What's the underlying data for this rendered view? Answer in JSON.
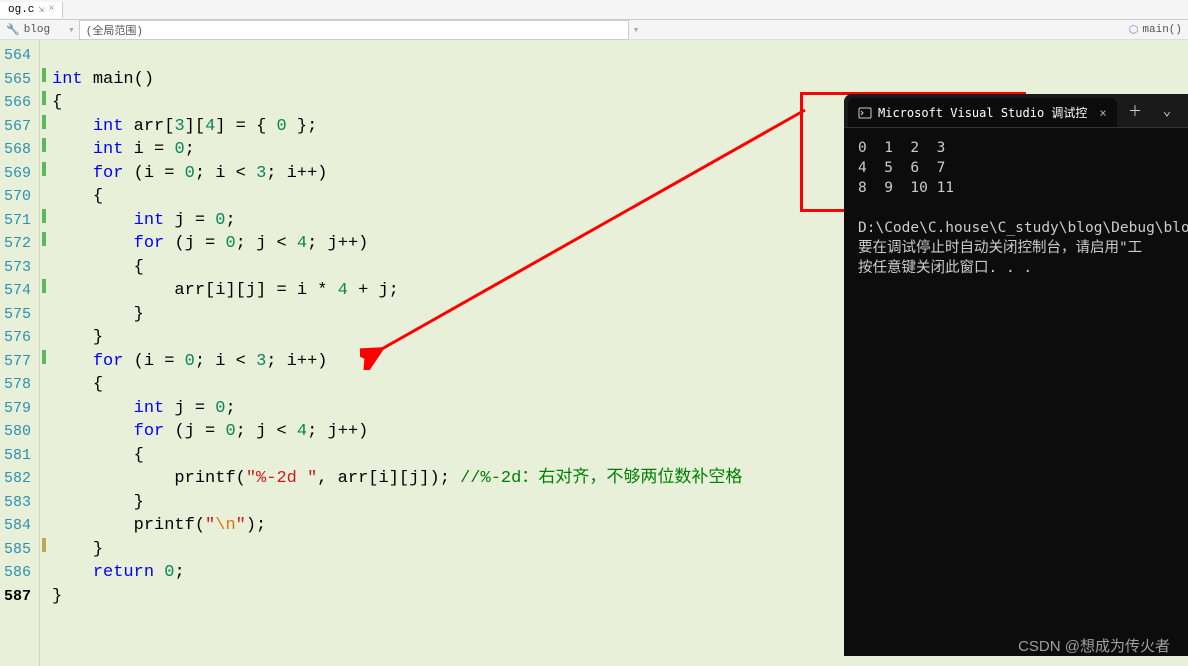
{
  "tab": {
    "name": "og.c",
    "pin": "⇲",
    "close": "×"
  },
  "nav": {
    "scope_icon": "🔧",
    "scope": "blog",
    "dd": "(全局范围)",
    "func_icon": "⬡",
    "func": "main()"
  },
  "lines": {
    "start": 564,
    "current": 587,
    "marks": [
      "",
      "c",
      "c",
      "c",
      "c",
      "c",
      "",
      "c",
      "c",
      "",
      "c",
      "",
      "",
      "c",
      "",
      "",
      "",
      "",
      "",
      "",
      "",
      "y",
      "",
      ""
    ]
  },
  "code": {
    "l565a": "int",
    "l565b": " main()",
    "l566": "{",
    "l567a": "    ",
    "l567b": "int",
    "l567c": " arr[",
    "l567d": "3",
    "l567e": "][",
    "l567f": "4",
    "l567g": "] = { ",
    "l567h": "0",
    "l567i": " };",
    "l568a": "    ",
    "l568b": "int",
    "l568c": " i = ",
    "l568d": "0",
    "l568e": ";",
    "l569a": "    ",
    "l569b": "for",
    "l569c": " (i = ",
    "l569d": "0",
    "l569e": "; i < ",
    "l569f": "3",
    "l569g": "; i++)",
    "l570": "    {",
    "l571a": "        ",
    "l571b": "int",
    "l571c": " j = ",
    "l571d": "0",
    "l571e": ";",
    "l572a": "        ",
    "l572b": "for",
    "l572c": " (j = ",
    "l572d": "0",
    "l572e": "; j < ",
    "l572f": "4",
    "l572g": "; j++)",
    "l573": "        {",
    "l574a": "            arr[i][j] = i * ",
    "l574b": "4",
    "l574c": " + j;",
    "l575": "        }",
    "l576": "    }",
    "l577a": "    ",
    "l577b": "for",
    "l577c": " (i = ",
    "l577d": "0",
    "l577e": "; i < ",
    "l577f": "3",
    "l577g": "; i++)",
    "l578": "    {",
    "l579a": "        ",
    "l579b": "int",
    "l579c": " j = ",
    "l579d": "0",
    "l579e": ";",
    "l580a": "        ",
    "l580b": "for",
    "l580c": " (j = ",
    "l580d": "0",
    "l580e": "; j < ",
    "l580f": "4",
    "l580g": "; j++)",
    "l581": "        {",
    "l582a": "            printf(",
    "l582b": "\"%-2d \"",
    "l582c": ", arr[i][j]); ",
    "l582d": "//%-2d：右对齐，不够两位数补空格",
    "l583": "        }",
    "l584a": "        printf(",
    "l584b": "\"",
    "l584c": "\\n",
    "l584d": "\"",
    "l584e": ");",
    "l585": "    }",
    "l586a": "    ",
    "l586b": "return",
    "l586c": " ",
    "l586d": "0",
    "l586e": ";",
    "l587": "}"
  },
  "console": {
    "title": "Microsoft Visual Studio 调试控",
    "close": "×",
    "plus": "＋",
    "chev": "⌄",
    "output": "0  1  2  3\n4  5  6  7\n8  9  10 11\n\nD:\\Code\\C.house\\C_study\\blog\\Debug\\blo\n要在调试停止时自动关闭控制台，请启用\"工\n按任意键关闭此窗口. . ."
  },
  "watermark": "CSDN @想成为传火者"
}
